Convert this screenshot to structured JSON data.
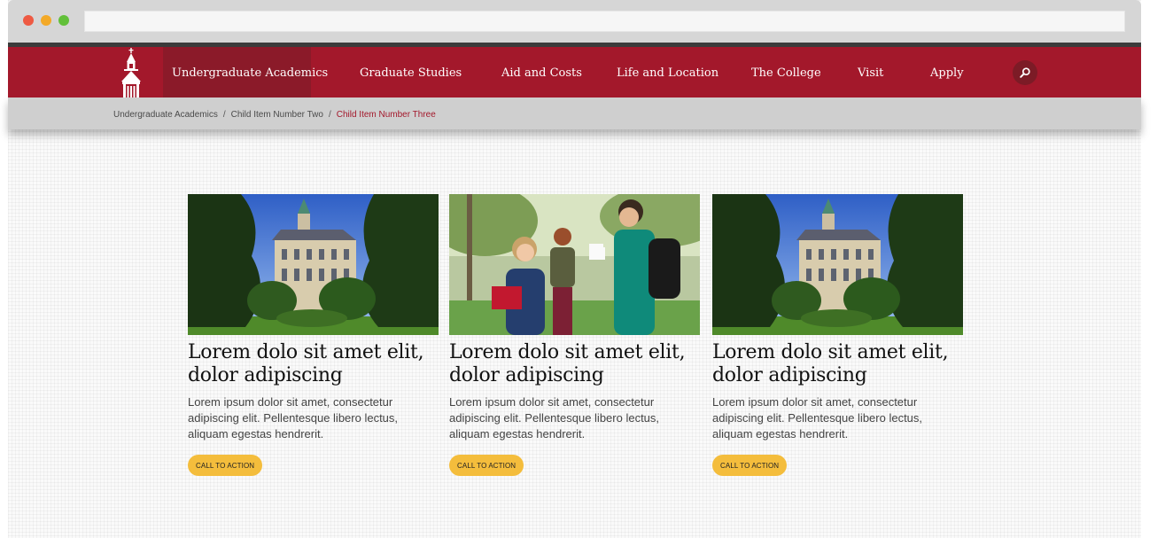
{
  "nav": {
    "items": [
      {
        "label": "Undergraduate Academics"
      },
      {
        "label": "Graduate Studies"
      },
      {
        "label": "Aid and Costs"
      },
      {
        "label": "Life and Location"
      },
      {
        "label": "The College"
      },
      {
        "label": "Visit"
      },
      {
        "label": "Apply"
      }
    ],
    "active_index": 0,
    "search_icon": "search-icon"
  },
  "breadcrumb": {
    "items": [
      "Undergraduate Academics",
      "Child Item Number Two"
    ],
    "current": "Child Item Number Three",
    "separator": "/"
  },
  "cards": [
    {
      "image": "campus-building-photo",
      "title": "Lorem dolo sit amet elit, dolor adipiscing",
      "body": "Lorem ipsum dolor sit amet, consectetur adipiscing elit. Pellentesque libero lectus, aliquam egestas hendrerit.",
      "cta": "CALL TO ACTION"
    },
    {
      "image": "students-walking-photo",
      "title": "Lorem dolo sit amet elit, dolor adipiscing",
      "body": "Lorem ipsum dolor sit amet, consectetur adipiscing elit. Pellentesque libero lectus, aliquam egestas hendrerit.",
      "cta": "CALL TO ACTION"
    },
    {
      "image": "campus-building-photo",
      "title": "Lorem dolo sit amet elit, dolor adipiscing",
      "body": "Lorem ipsum dolor sit amet, consectetur adipiscing elit. Pellentesque libero lectus, aliquam egestas hendrerit.",
      "cta": "CALL TO ACTION"
    }
  ],
  "colors": {
    "brand_red": "#a3182b",
    "nav_active": "#8b1a29",
    "cta_yellow": "#f4bd3c",
    "breadcrumb_current": "#a3182b"
  }
}
